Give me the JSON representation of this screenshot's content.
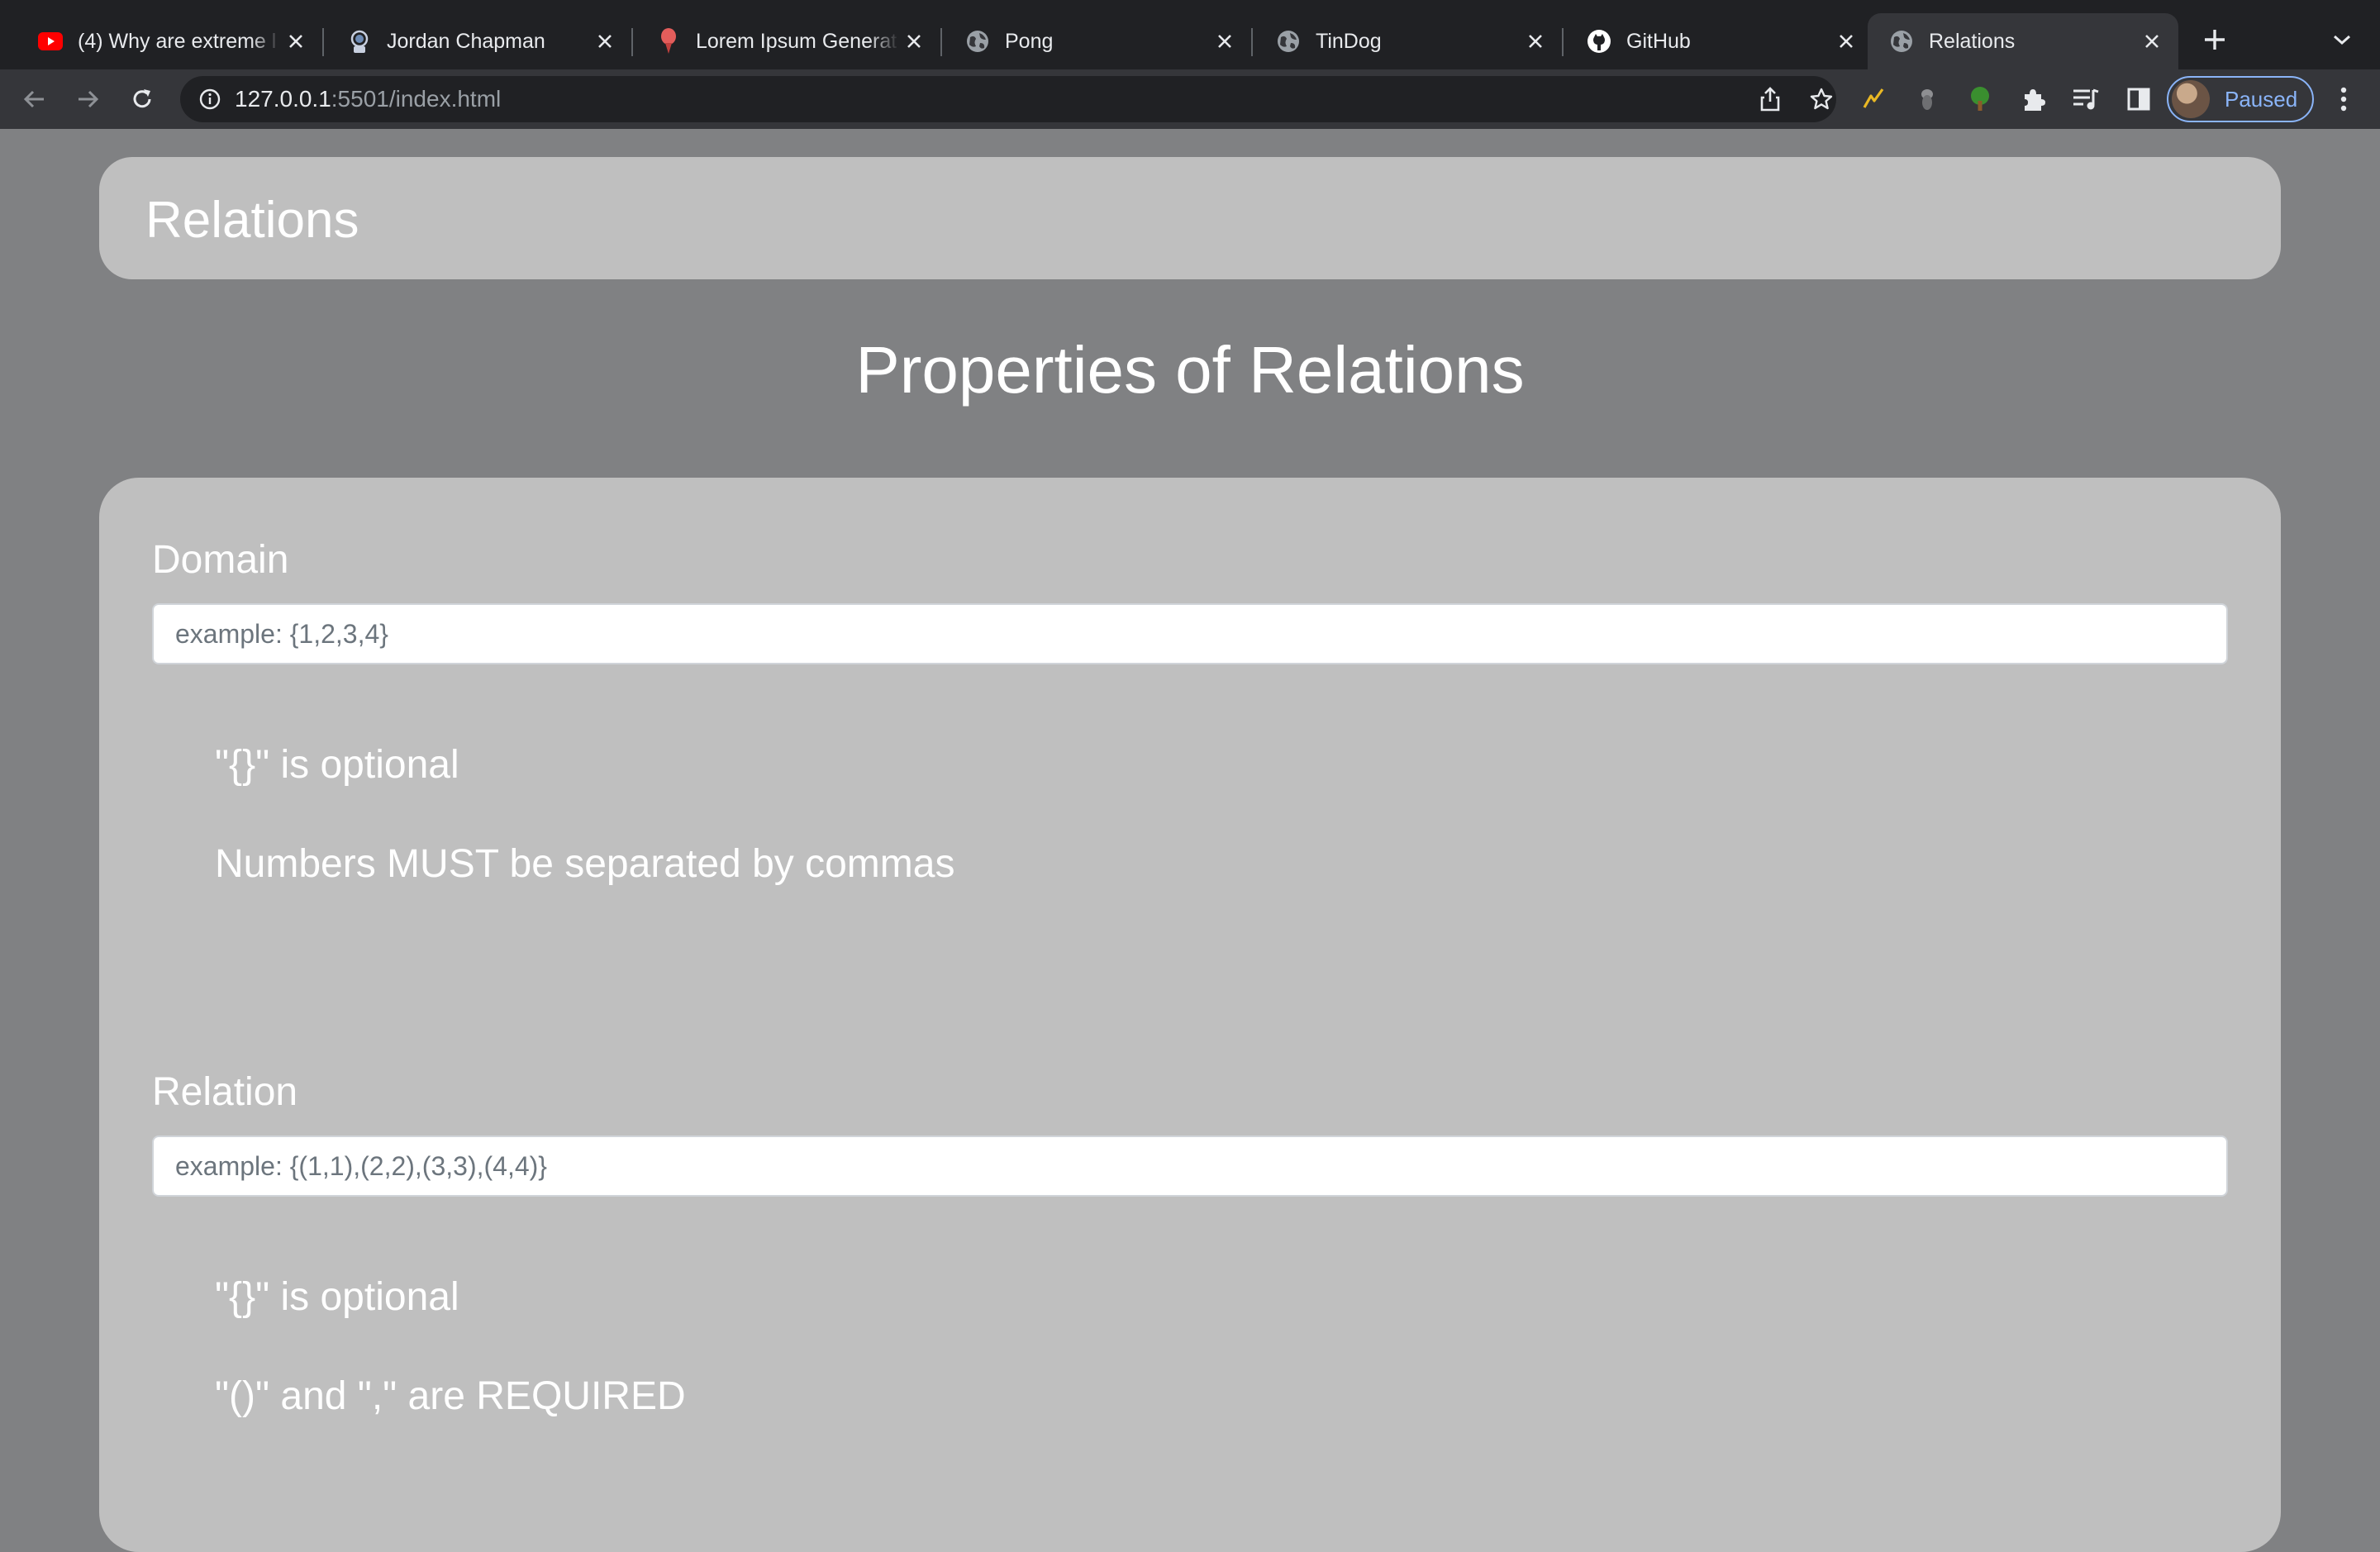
{
  "browser": {
    "tabs": [
      {
        "title": "(4) Why are extreme l",
        "icon": "youtube-icon",
        "active": false
      },
      {
        "title": "Jordan Chapman",
        "icon": "astronaut-icon",
        "active": false
      },
      {
        "title": "Lorem Ipsum Generat",
        "icon": "pin-icon",
        "active": false
      },
      {
        "title": "Pong",
        "icon": "globe-icon",
        "active": false
      },
      {
        "title": "TinDog",
        "icon": "globe-icon",
        "active": false
      },
      {
        "title": "GitHub",
        "icon": "github-icon",
        "active": false
      },
      {
        "title": "Relations",
        "icon": "globe-icon",
        "active": true
      }
    ],
    "url_host": "127.0.0.1",
    "url_rest": ":5501/index.html",
    "profile_status": "Paused"
  },
  "page": {
    "brand": "Relations",
    "heading": "Properties of Relations",
    "sections": [
      {
        "label": "Domain",
        "placeholder": "example: {1,2,3,4}",
        "hints": [
          "\"{}\" is optional",
          "Numbers MUST be separated by commas"
        ]
      },
      {
        "label": "Relation",
        "placeholder": "example: {(1,1),(2,2),(3,3),(4,4)}",
        "hints": [
          "\"{}\" is optional",
          "\"()\" and \",\" are REQUIRED"
        ]
      }
    ]
  },
  "colors": {
    "page_bg": "#808183",
    "panel_bg": "#bfbfbf",
    "chrome_dark": "#202124",
    "chrome_toolbar": "#35363a",
    "profile_accent": "#8ab4f8"
  }
}
